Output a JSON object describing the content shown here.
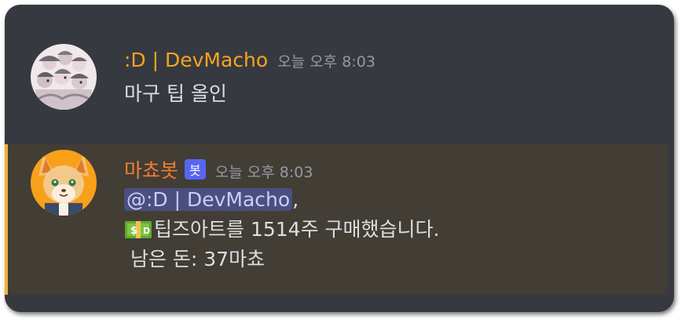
{
  "messages": [
    {
      "author": ":D | DevMacho",
      "timestamp": "오늘 오후 8:03",
      "text": "마구 팁 올인"
    },
    {
      "author": "마쵸봇",
      "bot_tag": "봇",
      "timestamp": "오늘 오후 8:03",
      "mention": "@:D | DevMacho",
      "mention_suffix": ",",
      "line2_icon": "money-dollar-icon",
      "line2_text": "팁즈아트를 1514주 구매했습니다.",
      "line3_text": " 남은 돈: 37마쵸"
    }
  ],
  "colors": {
    "background": "#36393f",
    "highlight_bg": "#423d35",
    "highlight_bar": "#f0b232",
    "author1": "#f7a51f",
    "author2": "#f47b35",
    "bot_tag": "#5865f2",
    "mention_bg": "#4a4f80"
  }
}
